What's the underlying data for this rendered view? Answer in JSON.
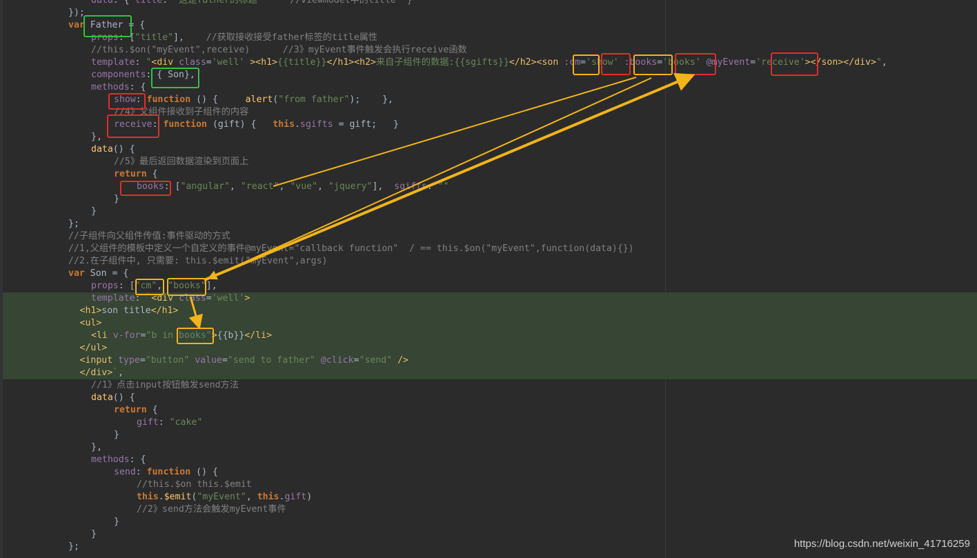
{
  "editor": {
    "theme_colors": {
      "background": "#2b2b2b",
      "current_block_highlight": "#364534",
      "keyword": "#cc7832",
      "string": "#6a8759",
      "comment": "#808080",
      "property": "#9876aa",
      "function": "#ffc66d",
      "tag": "#e8bf6a",
      "plain": "#a9b7c6"
    },
    "annotation_colors": {
      "red": "#e02d2d",
      "yellow": "#f2b418",
      "green": "#2ec340"
    },
    "code": [
      {
        "d": 2,
        "tk": [
          [
            "pr",
            "data"
          ],
          [
            "pl",
            ": { "
          ],
          [
            "pr",
            "title"
          ],
          [
            "pl",
            ": "
          ],
          [
            "str",
            "\"这是father的标题\""
          ],
          [
            "cm",
            "     //viewmodel中的title  }"
          ]
        ]
      },
      {
        "d": 1,
        "tk": [
          [
            "pl",
            "});"
          ]
        ]
      },
      {
        "d": 1,
        "tk": [
          [
            "kw",
            "var"
          ],
          [
            "pl",
            " "
          ],
          [
            "pl",
            "Father"
          ],
          [
            "pl",
            " = {"
          ]
        ]
      },
      {
        "d": 2,
        "tk": [
          [
            "pr",
            "props"
          ],
          [
            "pl",
            ": ["
          ],
          [
            "str",
            "\"title\""
          ],
          [
            "pl",
            "],    "
          ],
          [
            "cm",
            "//获取接收接受father标签的title属性"
          ]
        ]
      },
      {
        "d": 2,
        "tk": [
          [
            "cm",
            "//this.$on(\"myEvent\",receive)      //3》myEvent事件触发会执行receive函数"
          ]
        ]
      },
      {
        "d": 2,
        "tk": [
          [
            "pr",
            "template"
          ],
          [
            "pl",
            ": "
          ],
          [
            "str",
            "\""
          ],
          [
            "tg",
            "<div "
          ],
          [
            "pr",
            "class"
          ],
          [
            "pl",
            "="
          ],
          [
            "str",
            "'well' "
          ],
          [
            "tg",
            ">"
          ],
          [
            "tg",
            "<h1>"
          ],
          [
            "str",
            "{{title}}"
          ],
          [
            "tg",
            "</h1>"
          ],
          [
            "tg",
            "<h2>"
          ],
          [
            "str",
            "来自子组件的数据:{{sgifts}}"
          ],
          [
            "tg",
            "</h2>"
          ],
          [
            "tg",
            "<son "
          ],
          [
            "pr",
            ":cm"
          ],
          [
            "pl",
            "="
          ],
          [
            "str",
            "'show' "
          ],
          [
            "pr",
            ":books"
          ],
          [
            "pl",
            "="
          ],
          [
            "str",
            "'books' "
          ],
          [
            "pr",
            "@myEvent"
          ],
          [
            "pl",
            "="
          ],
          [
            "str",
            "'receive'"
          ],
          [
            "tg",
            ">"
          ],
          [
            "tg",
            "</son>"
          ],
          [
            "tg",
            "</div>"
          ],
          [
            "str",
            "\""
          ],
          [
            "pl",
            ","
          ]
        ]
      },
      {
        "d": 2,
        "tk": [
          [
            "pr",
            "components"
          ],
          [
            "pl",
            ": { Son},"
          ]
        ]
      },
      {
        "d": 2,
        "tk": [
          [
            "pr",
            "methods"
          ],
          [
            "pl",
            ": {"
          ]
        ]
      },
      {
        "d": 3,
        "tk": [
          [
            "pr",
            "show"
          ],
          [
            "pl",
            ": "
          ],
          [
            "kw",
            "function"
          ],
          [
            "pl",
            " () {     "
          ],
          [
            "fn",
            "alert"
          ],
          [
            "pl",
            "("
          ],
          [
            "str",
            "\"from father\""
          ],
          [
            "pl",
            ");    },"
          ]
        ]
      },
      {
        "d": 3,
        "tk": [
          [
            "cm",
            "//4》父组件接收到子组件的内容"
          ]
        ]
      },
      {
        "d": 3,
        "tk": [
          [
            "pr",
            "receive"
          ],
          [
            "pl",
            ": "
          ],
          [
            "kw",
            "function"
          ],
          [
            "pl",
            " (gift) {   "
          ],
          [
            "kw",
            "this"
          ],
          [
            "pl",
            "."
          ],
          [
            "pr",
            "sgifts"
          ],
          [
            "pl",
            " = gift;   }"
          ]
        ]
      },
      {
        "d": 2,
        "tk": [
          [
            "pl",
            "},"
          ]
        ]
      },
      {
        "d": 2,
        "tk": [
          [
            "fn",
            "data"
          ],
          [
            "pl",
            "() {"
          ]
        ]
      },
      {
        "d": 3,
        "tk": [
          [
            "cm",
            "//5》最后返回数据渲染到页面上"
          ]
        ]
      },
      {
        "d": 3,
        "tk": [
          [
            "kw",
            "return"
          ],
          [
            "pl",
            " {"
          ]
        ]
      },
      {
        "d": 4,
        "tk": [
          [
            "pr",
            "books"
          ],
          [
            "pl",
            ": ["
          ],
          [
            "str",
            "\"angular\""
          ],
          [
            "pl",
            ", "
          ],
          [
            "str",
            "\"react\""
          ],
          [
            "pl",
            ", "
          ],
          [
            "str",
            "\"vue\""
          ],
          [
            "pl",
            ", "
          ],
          [
            "str",
            "\"jquery\""
          ],
          [
            "pl",
            "],  "
          ],
          [
            "pr",
            "sgifts"
          ],
          [
            "pl",
            ": "
          ],
          [
            "str",
            "\"\""
          ]
        ]
      },
      {
        "d": 3,
        "tk": [
          [
            "pl",
            "}"
          ]
        ]
      },
      {
        "d": 2,
        "tk": [
          [
            "pl",
            "}"
          ]
        ]
      },
      {
        "d": 1,
        "tk": [
          [
            "pl",
            "};"
          ]
        ]
      },
      {
        "d": 1,
        "tk": [
          [
            "cm",
            "//子组件向父组件传值:事件驱动的方式"
          ]
        ]
      },
      {
        "d": 1,
        "tk": [
          [
            "cm",
            "//1,父组件的模板中定义一个自定义的事件@myEvent=\"callback function\"  / == this.$on(\"myEvent\",function(data){})"
          ]
        ]
      },
      {
        "d": 1,
        "tk": [
          [
            "cm",
            "//2.在子组件中, 只需要: this.$emit(\"myEvent\",args)"
          ]
        ]
      },
      {
        "d": 1,
        "tk": [
          [
            "kw",
            "var"
          ],
          [
            "pl",
            " "
          ],
          [
            "pl",
            "Son"
          ],
          [
            "pl",
            " = {"
          ]
        ]
      },
      {
        "d": 2,
        "tk": [
          [
            "pr",
            "props"
          ],
          [
            "pl",
            ": ["
          ],
          [
            "str",
            "\"cm\""
          ],
          [
            "pl",
            ", "
          ],
          [
            "str",
            "\"books\""
          ],
          [
            "pl",
            "],"
          ]
        ]
      },
      {
        "d": 2,
        "tk": [
          [
            "pr",
            "template"
          ],
          [
            "pl",
            ": "
          ],
          [
            "str",
            "`"
          ],
          [
            "tg",
            "<div "
          ],
          [
            "pr",
            "class"
          ],
          [
            "pl",
            "="
          ],
          [
            "str",
            "'well'"
          ],
          [
            "tg",
            ">"
          ]
        ]
      },
      {
        "d": 1.5,
        "tk": [
          [
            "tg",
            "<h1>"
          ],
          [
            "pl",
            "son title"
          ],
          [
            "tg",
            "</h1>"
          ]
        ]
      },
      {
        "d": 1.5,
        "tk": [
          [
            "tg",
            "<ul>"
          ]
        ]
      },
      {
        "d": 2,
        "tk": [
          [
            "tg",
            "<li "
          ],
          [
            "pr",
            "v-for"
          ],
          [
            "pl",
            "="
          ],
          [
            "str",
            "\"b in books\""
          ],
          [
            "tg",
            ">"
          ],
          [
            "pl",
            "{{b}}"
          ],
          [
            "tg",
            "</li>"
          ]
        ]
      },
      {
        "d": 1.5,
        "tk": [
          [
            "tg",
            "</ul>"
          ]
        ]
      },
      {
        "d": 1.5,
        "tk": [
          [
            "tg",
            "<input "
          ],
          [
            "pr",
            "type"
          ],
          [
            "pl",
            "="
          ],
          [
            "str",
            "\"button\" "
          ],
          [
            "pr",
            "value"
          ],
          [
            "pl",
            "="
          ],
          [
            "str",
            "\"send to father\" "
          ],
          [
            "pr",
            "@click"
          ],
          [
            "pl",
            "="
          ],
          [
            "str",
            "\"send\" "
          ],
          [
            "tg",
            "/>"
          ]
        ]
      },
      {
        "d": 1.5,
        "tk": [
          [
            "tg",
            "</div>"
          ],
          [
            "str",
            "`"
          ],
          [
            "pl",
            ","
          ]
        ]
      },
      {
        "d": 2,
        "tk": [
          [
            "cm",
            "//1》点击input按钮触发send方法"
          ]
        ]
      },
      {
        "d": 2,
        "tk": [
          [
            "fn",
            "data"
          ],
          [
            "pl",
            "() {"
          ]
        ]
      },
      {
        "d": 3,
        "tk": [
          [
            "kw",
            "return"
          ],
          [
            "pl",
            " {"
          ]
        ]
      },
      {
        "d": 4,
        "tk": [
          [
            "pr",
            "gift"
          ],
          [
            "pl",
            ": "
          ],
          [
            "str",
            "\"cake\""
          ]
        ]
      },
      {
        "d": 3,
        "tk": [
          [
            "pl",
            "}"
          ]
        ]
      },
      {
        "d": 2,
        "tk": [
          [
            "pl",
            "},"
          ]
        ]
      },
      {
        "d": 2,
        "tk": [
          [
            "pr",
            "methods"
          ],
          [
            "pl",
            ": {"
          ]
        ]
      },
      {
        "d": 3,
        "tk": [
          [
            "pr",
            "send"
          ],
          [
            "pl",
            ": "
          ],
          [
            "kw",
            "function"
          ],
          [
            "pl",
            " () {"
          ]
        ]
      },
      {
        "d": 4,
        "tk": [
          [
            "cm",
            "//this.$on this.$emit"
          ]
        ]
      },
      {
        "d": 4,
        "tk": [
          [
            "kw",
            "this"
          ],
          [
            "pl",
            "."
          ],
          [
            "fn",
            "$emit"
          ],
          [
            "pl",
            "("
          ],
          [
            "str",
            "\"myEvent\""
          ],
          [
            "pl",
            ", "
          ],
          [
            "kw",
            "this"
          ],
          [
            "pl",
            "."
          ],
          [
            "pr",
            "gift"
          ],
          [
            "pl",
            ")"
          ]
        ]
      },
      {
        "d": 4,
        "tk": [
          [
            "cm",
            "//2》send方法会触发myEvent事件"
          ]
        ]
      },
      {
        "d": 3,
        "tk": [
          [
            "pl",
            "}"
          ]
        ]
      },
      {
        "d": 2,
        "tk": [
          [
            "pl",
            "}"
          ]
        ]
      },
      {
        "d": 1,
        "tk": [
          [
            "pl",
            "};"
          ]
        ]
      }
    ]
  },
  "annotations": {
    "boxes": [
      {
        "name": "father-var-box",
        "color": "green"
      },
      {
        "name": "components-son-box",
        "color": "green"
      },
      {
        "name": "template-cm-attr-box",
        "color": "yellow"
      },
      {
        "name": "template-show-value-box",
        "color": "red"
      },
      {
        "name": "template-books-attr-box",
        "color": "yellow"
      },
      {
        "name": "template-books-value-box",
        "color": "red"
      },
      {
        "name": "template-receive-value-box",
        "color": "red"
      },
      {
        "name": "method-show-box",
        "color": "red"
      },
      {
        "name": "method-receive-box",
        "color": "red"
      },
      {
        "name": "data-books-box",
        "color": "red"
      },
      {
        "name": "son-props-cm-box",
        "color": "yellow"
      },
      {
        "name": "son-props-books-box",
        "color": "yellow"
      },
      {
        "name": "v-for-books-box",
        "color": "yellow"
      }
    ],
    "arrows_color": "#f2b418"
  },
  "watermark": "https://blog.csdn.net/weixin_41716259"
}
